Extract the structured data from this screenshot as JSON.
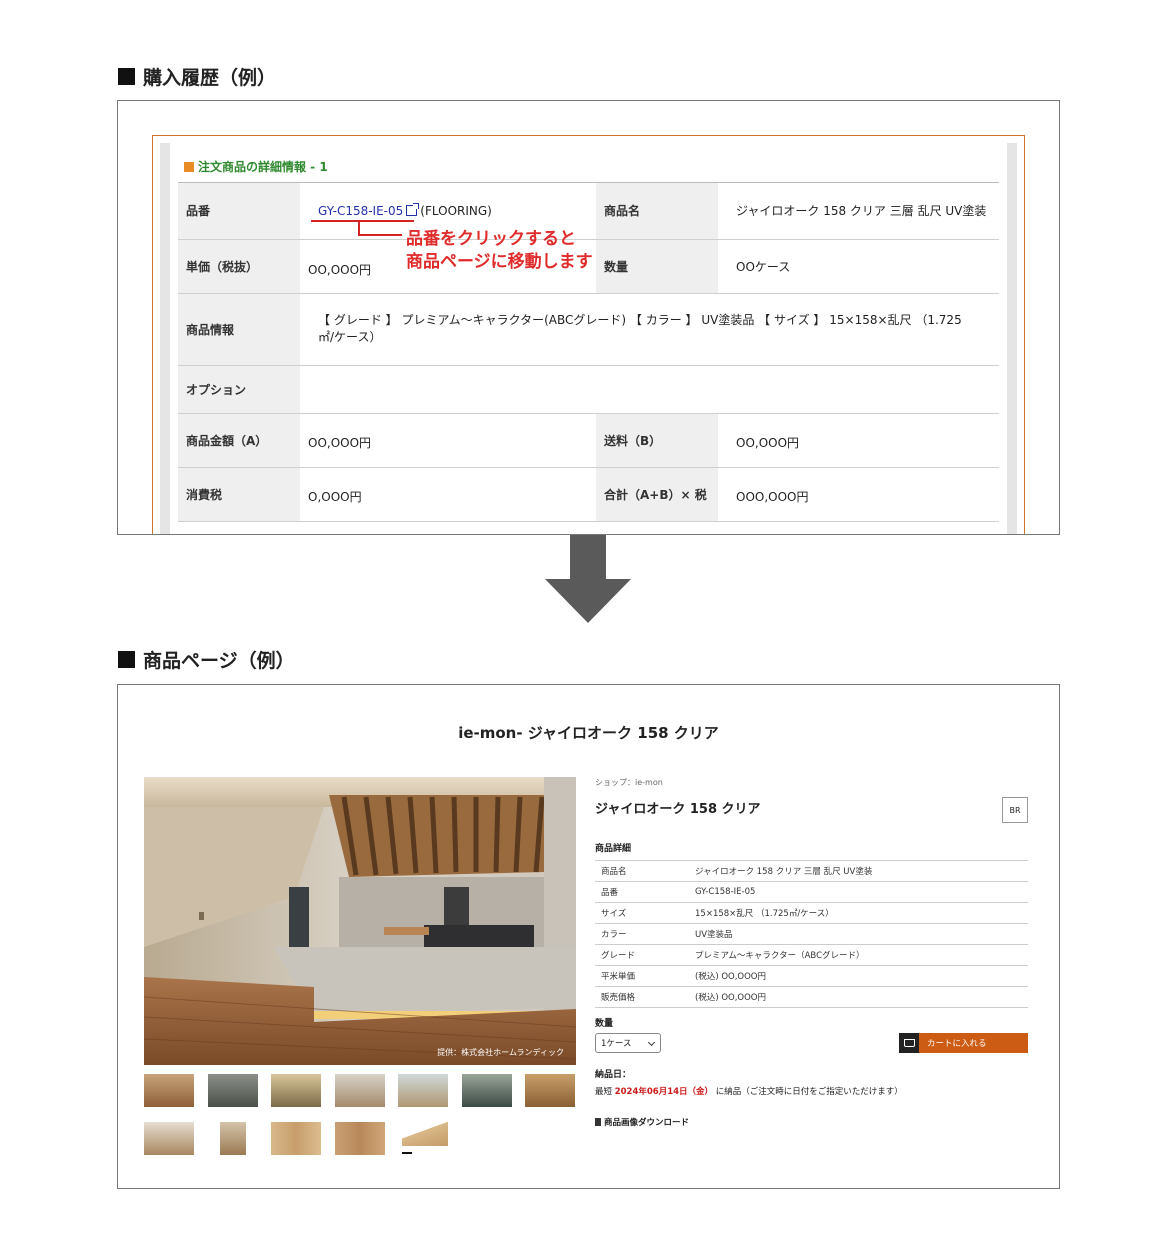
{
  "heading_purchase": "購入履歴（例）",
  "heading_product": "商品ページ（例）",
  "order_detail": {
    "heading": "注文商品の詳細情報 - 1",
    "part_number_label": "品番",
    "part_number": "GY-C158-IE-05",
    "category": "(FLOORING)",
    "product_name_label": "商品名",
    "product_name": "ジャイロオーク 158 クリア 三層 乱尺 UV塗装",
    "unit_price_label": "単価（税抜）",
    "unit_price": "OO,OOO円",
    "quantity_label": "数量",
    "quantity": "OOケース",
    "info_label": "商品情報",
    "info": "【 グレード 】 プレミアム～キャラクター(ABCグレード) 【 カラー 】 UV塗装品 【 サイズ 】 15×158×乱尺 （1.725㎡/ケース）",
    "option_label": "オプション",
    "option": "",
    "amount_label": "商品金額（A）",
    "amount": "OO,OOO円",
    "shipping_label": "送料（B）",
    "shipping": "OO,OOO円",
    "tax_label": "消費税",
    "tax": "O,OOO円",
    "total_label": "合計（A+B）× 税",
    "total": "OOO,OOO円"
  },
  "callout": {
    "line1": "品番をクリックすると",
    "line2": "商品ページに移動します"
  },
  "product_page": {
    "title": "ie-mon- ジャイロオーク 158 クリア",
    "shop": "ショップ：ie-mon",
    "name": "ジャイロオーク 158 クリア",
    "share_label": "BR",
    "photo_credit": "提供：株式会社ホームランディック",
    "spec_heading": "商品詳細",
    "specs": [
      {
        "key": "商品名",
        "value": "ジャイロオーク 158 クリア 三層 乱尺 UV塗装"
      },
      {
        "key": "品番",
        "value": "GY-C158-IE-05"
      },
      {
        "key": "サイズ",
        "value": "15×158×乱尺 （1.725㎡/ケース）"
      },
      {
        "key": "カラー",
        "value": "UV塗装品"
      },
      {
        "key": "グレード",
        "value": "プレミアム～キャラクター（ABCグレード）"
      },
      {
        "key": "平米単価",
        "value": "(税込) OO,OOO円"
      },
      {
        "key": "販売価格",
        "value": "(税込) OO,OOO円"
      }
    ],
    "qty_label": "数量",
    "qty_value": "1ケース",
    "cart_label": "カートに入れる",
    "delivery_label": "納品日：",
    "delivery_prefix": "最短",
    "delivery_date": "2024年06月14日（金）",
    "delivery_suffix": "に納品（ご注文時に日付をご指定いただけます）",
    "download_label": "商品画像ダウンロード"
  }
}
